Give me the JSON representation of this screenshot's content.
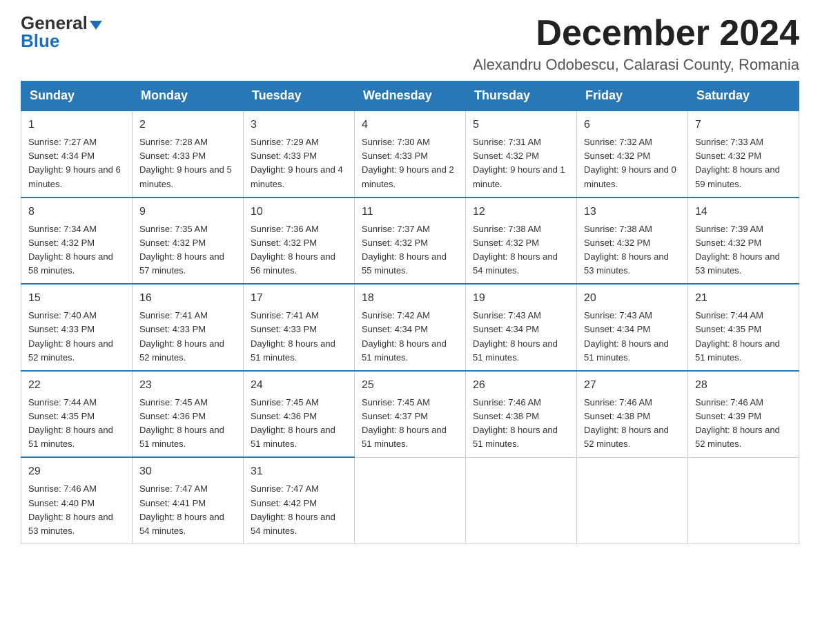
{
  "header": {
    "logo_general": "General",
    "logo_blue": "Blue",
    "month_title": "December 2024",
    "subtitle": "Alexandru Odobescu, Calarasi County, Romania"
  },
  "days_of_week": [
    "Sunday",
    "Monday",
    "Tuesday",
    "Wednesday",
    "Thursday",
    "Friday",
    "Saturday"
  ],
  "weeks": [
    [
      {
        "day": "1",
        "sunrise": "7:27 AM",
        "sunset": "4:34 PM",
        "daylight": "9 hours and 6 minutes."
      },
      {
        "day": "2",
        "sunrise": "7:28 AM",
        "sunset": "4:33 PM",
        "daylight": "9 hours and 5 minutes."
      },
      {
        "day": "3",
        "sunrise": "7:29 AM",
        "sunset": "4:33 PM",
        "daylight": "9 hours and 4 minutes."
      },
      {
        "day": "4",
        "sunrise": "7:30 AM",
        "sunset": "4:33 PM",
        "daylight": "9 hours and 2 minutes."
      },
      {
        "day": "5",
        "sunrise": "7:31 AM",
        "sunset": "4:32 PM",
        "daylight": "9 hours and 1 minute."
      },
      {
        "day": "6",
        "sunrise": "7:32 AM",
        "sunset": "4:32 PM",
        "daylight": "9 hours and 0 minutes."
      },
      {
        "day": "7",
        "sunrise": "7:33 AM",
        "sunset": "4:32 PM",
        "daylight": "8 hours and 59 minutes."
      }
    ],
    [
      {
        "day": "8",
        "sunrise": "7:34 AM",
        "sunset": "4:32 PM",
        "daylight": "8 hours and 58 minutes."
      },
      {
        "day": "9",
        "sunrise": "7:35 AM",
        "sunset": "4:32 PM",
        "daylight": "8 hours and 57 minutes."
      },
      {
        "day": "10",
        "sunrise": "7:36 AM",
        "sunset": "4:32 PM",
        "daylight": "8 hours and 56 minutes."
      },
      {
        "day": "11",
        "sunrise": "7:37 AM",
        "sunset": "4:32 PM",
        "daylight": "8 hours and 55 minutes."
      },
      {
        "day": "12",
        "sunrise": "7:38 AM",
        "sunset": "4:32 PM",
        "daylight": "8 hours and 54 minutes."
      },
      {
        "day": "13",
        "sunrise": "7:38 AM",
        "sunset": "4:32 PM",
        "daylight": "8 hours and 53 minutes."
      },
      {
        "day": "14",
        "sunrise": "7:39 AM",
        "sunset": "4:32 PM",
        "daylight": "8 hours and 53 minutes."
      }
    ],
    [
      {
        "day": "15",
        "sunrise": "7:40 AM",
        "sunset": "4:33 PM",
        "daylight": "8 hours and 52 minutes."
      },
      {
        "day": "16",
        "sunrise": "7:41 AM",
        "sunset": "4:33 PM",
        "daylight": "8 hours and 52 minutes."
      },
      {
        "day": "17",
        "sunrise": "7:41 AM",
        "sunset": "4:33 PM",
        "daylight": "8 hours and 51 minutes."
      },
      {
        "day": "18",
        "sunrise": "7:42 AM",
        "sunset": "4:34 PM",
        "daylight": "8 hours and 51 minutes."
      },
      {
        "day": "19",
        "sunrise": "7:43 AM",
        "sunset": "4:34 PM",
        "daylight": "8 hours and 51 minutes."
      },
      {
        "day": "20",
        "sunrise": "7:43 AM",
        "sunset": "4:34 PM",
        "daylight": "8 hours and 51 minutes."
      },
      {
        "day": "21",
        "sunrise": "7:44 AM",
        "sunset": "4:35 PM",
        "daylight": "8 hours and 51 minutes."
      }
    ],
    [
      {
        "day": "22",
        "sunrise": "7:44 AM",
        "sunset": "4:35 PM",
        "daylight": "8 hours and 51 minutes."
      },
      {
        "day": "23",
        "sunrise": "7:45 AM",
        "sunset": "4:36 PM",
        "daylight": "8 hours and 51 minutes."
      },
      {
        "day": "24",
        "sunrise": "7:45 AM",
        "sunset": "4:36 PM",
        "daylight": "8 hours and 51 minutes."
      },
      {
        "day": "25",
        "sunrise": "7:45 AM",
        "sunset": "4:37 PM",
        "daylight": "8 hours and 51 minutes."
      },
      {
        "day": "26",
        "sunrise": "7:46 AM",
        "sunset": "4:38 PM",
        "daylight": "8 hours and 51 minutes."
      },
      {
        "day": "27",
        "sunrise": "7:46 AM",
        "sunset": "4:38 PM",
        "daylight": "8 hours and 52 minutes."
      },
      {
        "day": "28",
        "sunrise": "7:46 AM",
        "sunset": "4:39 PM",
        "daylight": "8 hours and 52 minutes."
      }
    ],
    [
      {
        "day": "29",
        "sunrise": "7:46 AM",
        "sunset": "4:40 PM",
        "daylight": "8 hours and 53 minutes."
      },
      {
        "day": "30",
        "sunrise": "7:47 AM",
        "sunset": "4:41 PM",
        "daylight": "8 hours and 54 minutes."
      },
      {
        "day": "31",
        "sunrise": "7:47 AM",
        "sunset": "4:42 PM",
        "daylight": "8 hours and 54 minutes."
      },
      null,
      null,
      null,
      null
    ]
  ]
}
